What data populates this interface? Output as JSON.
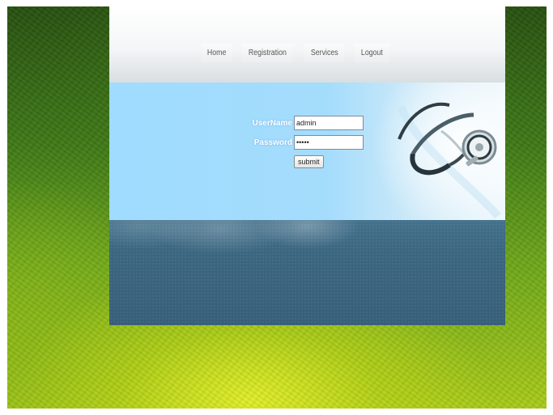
{
  "nav": {
    "items": [
      {
        "label": "Home"
      },
      {
        "label": "Registration"
      },
      {
        "label": "Services"
      },
      {
        "label": "Logout"
      }
    ]
  },
  "login": {
    "username_label": "UserName",
    "username_value": "admin",
    "password_label": "Password",
    "password_value": "admin",
    "submit_label": "submit"
  },
  "colors": {
    "banner": "#a4dcfc",
    "footer": "#3b6680",
    "background_green": "#6fa81a"
  },
  "icons": {
    "banner_image": "stethoscope-image"
  }
}
